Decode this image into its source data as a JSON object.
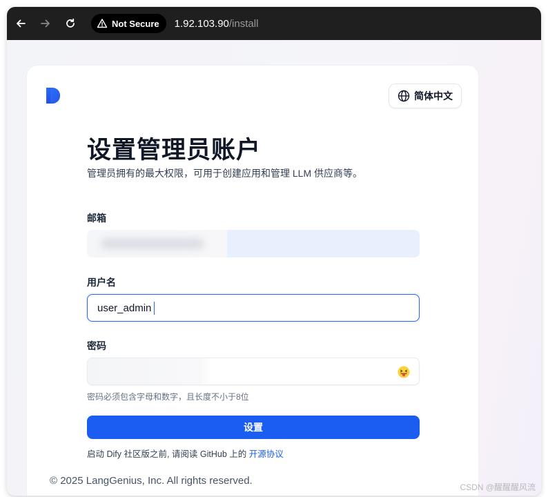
{
  "browser": {
    "security_label": "Not Secure",
    "url_host": "1.92.103.90",
    "url_path": "/install"
  },
  "header": {
    "language_label": "简体中文"
  },
  "form": {
    "title": "设置管理员账户",
    "subtitle": "管理员拥有的最大权限，可用于创建应用和管理 LLM 供应商等。",
    "email_label": "邮箱",
    "username_label": "用户名",
    "username_value": "user_admin",
    "password_label": "密码",
    "password_hint": "密码必须包含字母和数字，且长度不小于8位",
    "submit_label": "设置",
    "notice_prefix": "启动 Dify 社区版之前, 请阅读 GitHub 上的",
    "notice_link": "开源协议"
  },
  "footer": {
    "copyright": "© 2025 LangGenius, Inc. All rights reserved."
  },
  "watermark": "CSDN @醒醒醒风流",
  "colors": {
    "accent": "#1a5df0",
    "toolbar_bg": "#1f1f1f",
    "focus_border": "#2d63f0"
  },
  "icons": {
    "back": "back-arrow-icon",
    "forward": "forward-arrow-icon",
    "reload": "reload-icon",
    "warning": "warning-icon",
    "globe": "globe-icon",
    "password_toggle": "tongue-emoji-icon"
  }
}
